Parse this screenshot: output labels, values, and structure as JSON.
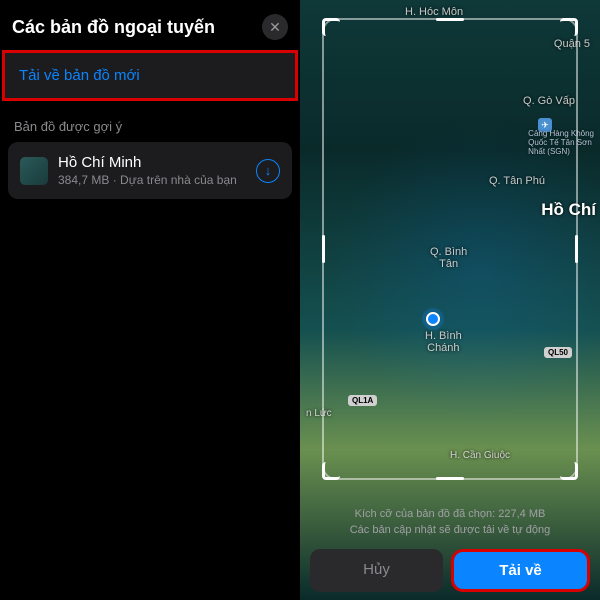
{
  "left": {
    "title": "Các bản đồ ngoại tuyến",
    "new_map": "Tải về bản đồ mới",
    "section_label": "Bản đồ được gợi ý",
    "suggested": {
      "name": "Hồ Chí Minh",
      "detail": "384,7 MB · Dựa trên nhà của bạn"
    }
  },
  "right": {
    "labels": {
      "hocmon": "H. Hóc Môn",
      "quan5": "Quận 5",
      "govap": "Q. Gò Vấp",
      "tanphu": "Q. Tân Phú",
      "hochi": "Hồ Chí",
      "binhtan": "Q. Bình\nTân",
      "binhchanh": "H. Bình\nChánh",
      "cangio": "H. Cần Giuộc",
      "cuchi": "n Lức",
      "airport": "Cảng Hàng Không\nQuốc Tế Tân Sơn\nNhất (SGN)",
      "ql50": "QL50",
      "ql1a": "QL1A"
    },
    "size_line": "Kích cỡ của bản đồ đã chọn: 227,4 MB",
    "update_line": "Các bản cập nhật sẽ được tải về tự động",
    "cancel": "Hủy",
    "download": "Tải về"
  }
}
